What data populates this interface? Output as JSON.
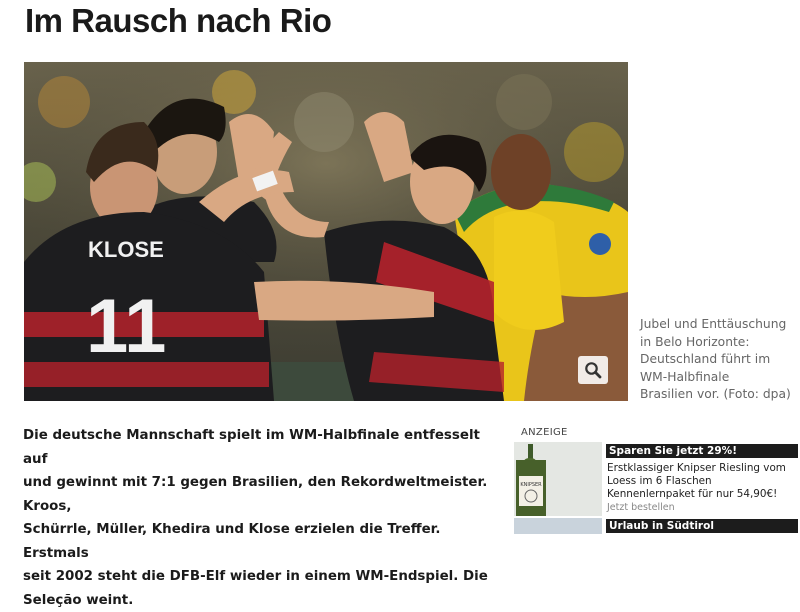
{
  "headline": "Im Rausch nach Rio",
  "image": {
    "jersey_name": "KLOSE",
    "jersey_number": "11",
    "zoom_icon": "magnifier-icon"
  },
  "caption": {
    "lines": [
      "Jubel und Enttäuschung",
      "in Belo Horizonte:",
      "Deutschland führt im",
      "WM-Halbfinale",
      "Brasilien vor."
    ],
    "credit": " (Foto: dpa)"
  },
  "article": {
    "lines": [
      "Die deutsche Mannschaft spielt im WM-Halbfinale entfesselt auf",
      "und gewinnt mit 7:1 gegen Brasilien, den Rekordweltmeister. Kroos,",
      "Schürrle, Müller, Khedira und Klose erzielen die Treffer. Erstmals",
      "seit 2002 steht die DFB-Elf wieder in einem WM-Endspiel. Die",
      "Seleção weint."
    ]
  },
  "ads": {
    "label": "ANZEIGE",
    "items": [
      {
        "title": "Sparen Sie jetzt 29%!",
        "text": "Erstklassiger Knipser Riesling vom Loess im 6 Flaschen Kennenlernpaket für nur 54,90€!",
        "cta": "Jetzt bestellen",
        "bottle_label": "KNIPSER"
      },
      {
        "title": "Urlaub in Südtirol"
      }
    ]
  }
}
